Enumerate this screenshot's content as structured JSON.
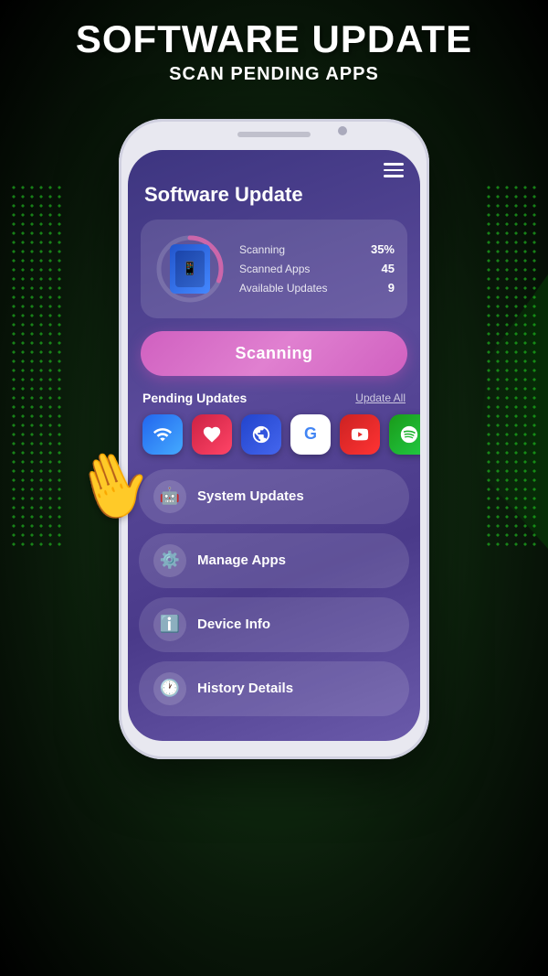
{
  "header": {
    "title": "SOFTWARE UPDATE",
    "subtitle": "SCAN PENDING APPS"
  },
  "screen": {
    "app_title": "Software Update",
    "hamburger_label": "menu",
    "scan_card": {
      "scanning_label": "Scanning",
      "scanning_value": "35%",
      "scanned_apps_label": "Scanned Apps",
      "scanned_apps_value": "45",
      "available_updates_label": "Available Updates",
      "available_updates_value": "9",
      "progress_percent": 35
    },
    "scan_button_label": "Scanning",
    "pending_section": {
      "title": "Pending Updates",
      "update_all_label": "Update All",
      "apps": [
        {
          "name": "wifi-app",
          "icon": "📶",
          "style": "wifi"
        },
        {
          "name": "heart-app",
          "icon": "❤️",
          "style": "heart"
        },
        {
          "name": "globe-app",
          "icon": "🌐",
          "style": "globe"
        },
        {
          "name": "google-app",
          "icon": "G",
          "style": "google"
        },
        {
          "name": "youtube-app",
          "icon": "▶",
          "style": "youtube"
        },
        {
          "name": "spotify-app",
          "icon": "♪",
          "style": "spotify"
        }
      ]
    },
    "menu_items": [
      {
        "id": "system-updates",
        "icon": "🤖",
        "label": "System Updates"
      },
      {
        "id": "manage-apps",
        "icon": "⚙️",
        "label": "Manage Apps"
      },
      {
        "id": "device-info",
        "icon": "ℹ️",
        "label": "Device Info"
      },
      {
        "id": "history-details",
        "icon": "🕐",
        "label": "History Details"
      }
    ]
  },
  "colors": {
    "bg_start": "#1a4a1a",
    "bg_end": "#000000",
    "screen_bg": "#3d3580",
    "scan_button": "#d060c0",
    "progress_color": "#cc66aa"
  }
}
